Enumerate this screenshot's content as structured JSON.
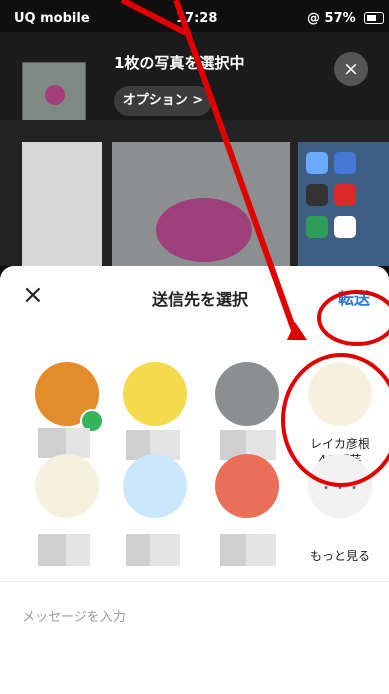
{
  "status_bar": {
    "carrier": "UQ mobile",
    "time": "17:28",
    "battery": "@ 57%"
  },
  "share_header": {
    "selected_text": "1枚の写真を選択中",
    "options_label": "オプション >",
    "close_symbol": "×"
  },
  "sheet": {
    "close_symbol": "×",
    "title": "送信先を選択",
    "forward_label": "転送"
  },
  "recipients": {
    "featured_name_line1": "レイカ彦根",
    "featured_name_line2": "44 園芸",
    "more_label": "もっと見る",
    "more_symbol": "・・・"
  },
  "message": {
    "placeholder": "メッセージを入力"
  },
  "colors": {
    "forward_blue": "#2a78d8",
    "highlight_red": "#e10000"
  },
  "icons": [
    "signal-icon",
    "wifi-icon",
    "battery-icon",
    "close-icon",
    "chevron-right-icon",
    "checkmark-icon",
    "person-icon",
    "more-icon"
  ]
}
